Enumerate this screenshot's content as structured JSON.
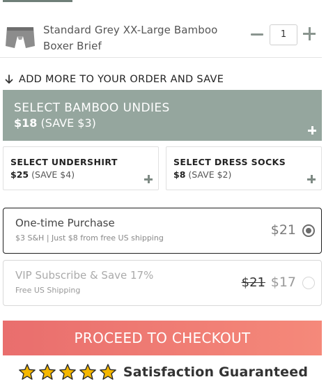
{
  "cart_item": {
    "name": "Standard Grey XX-Large Bamboo Boxer Brief",
    "quantity": "1",
    "thumbnail_icon": "boxer-brief-icon",
    "minus_icon": "minus-icon",
    "plus_icon": "plus-icon"
  },
  "upsell": {
    "heading": "ADD MORE TO YOUR ORDER AND SAVE",
    "heading_icon": "arrow-down-icon",
    "main": {
      "title": "SELECT BAMBOO UNDIES",
      "price": "$18",
      "save": "(SAVE $3)"
    },
    "cards": [
      {
        "title": "SELECT UNDERSHIRT",
        "price": "$25",
        "save": "(SAVE $4)"
      },
      {
        "title": "SELECT DRESS SOCKS",
        "price": "$8",
        "save": "(SAVE $2)"
      }
    ]
  },
  "purchase_options": [
    {
      "title": "One-time Purchase",
      "subtitle": "$3 S&H | Just $8 from free US shipping",
      "price": "$21",
      "selected": true
    },
    {
      "title": "VIP Subscribe & Save 17%",
      "subtitle": "Free US Shipping",
      "old_price": "$21",
      "price": "$17",
      "selected": false
    }
  ],
  "checkout": {
    "label": "PROCEED TO CHECKOUT"
  },
  "satisfaction": {
    "rating_stars": 5,
    "text": "Satisfaction Guaranteed"
  },
  "colors": {
    "sage_accent": "#95a69e",
    "checkout_gradient_start": "#e96e6d",
    "checkout_gradient_end": "#f5897a",
    "star_fill": "#f5b700"
  }
}
